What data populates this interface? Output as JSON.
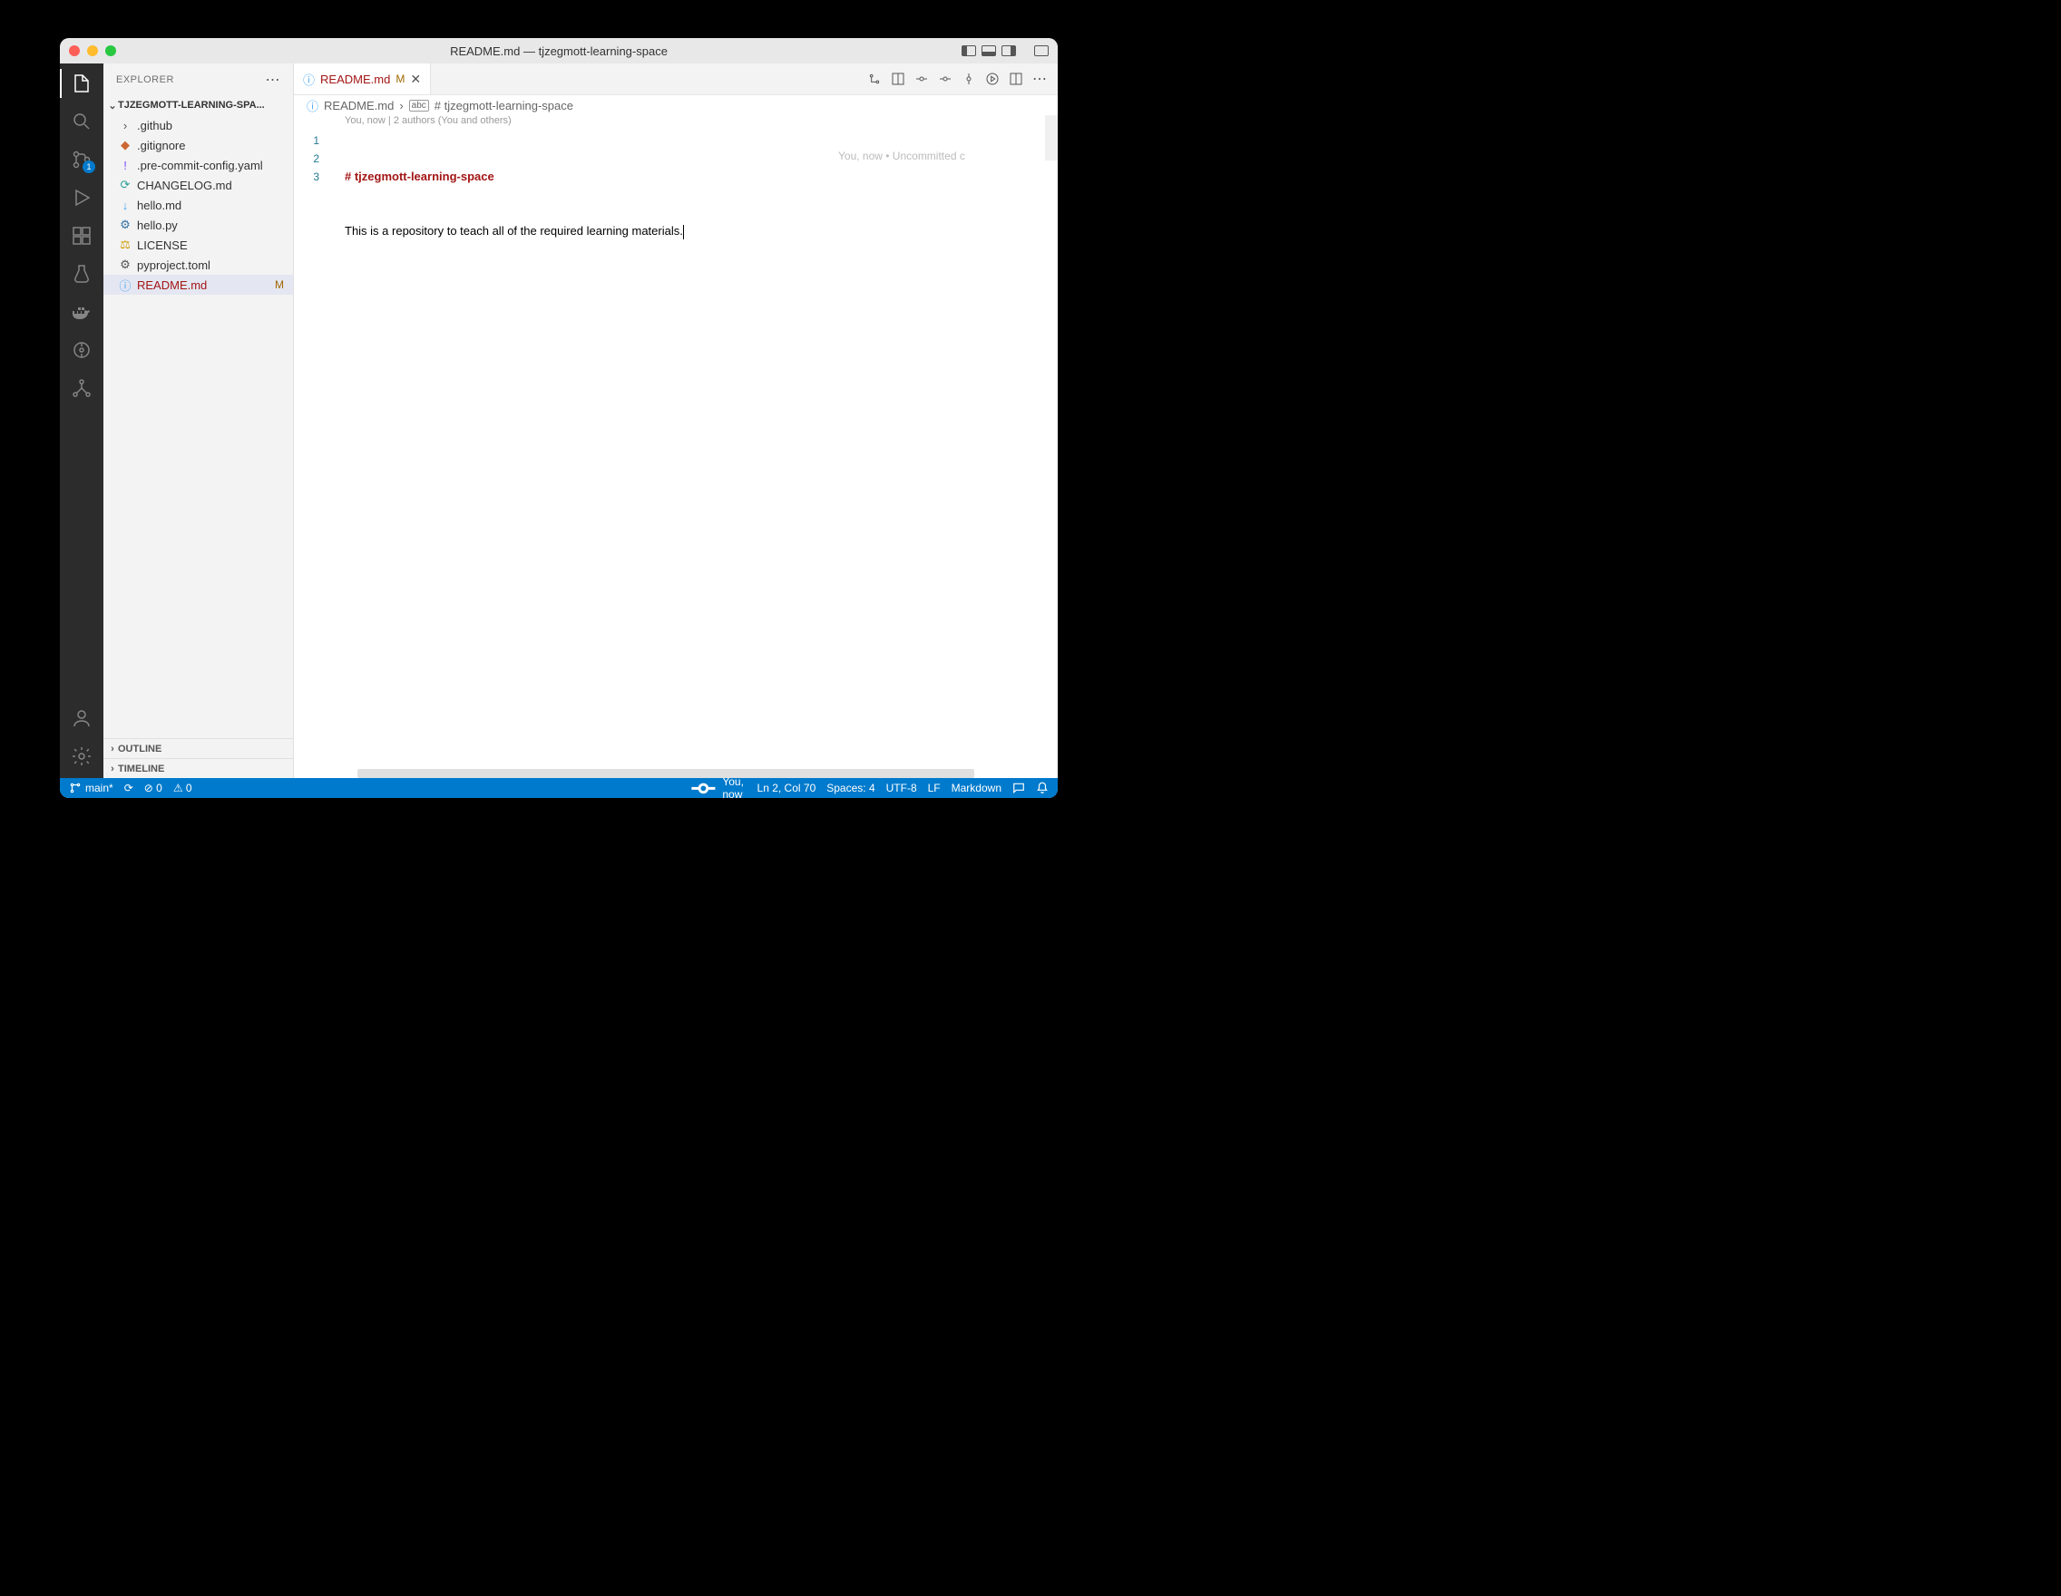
{
  "window": {
    "title": "README.md — tjzegmott-learning-space"
  },
  "traffic": {
    "close": "#ff5f57",
    "min": "#febc2e",
    "max": "#28c840"
  },
  "sidebar": {
    "title": "EXPLORER",
    "project": "TJZEGMOTT-LEARNING-SPA...",
    "files": [
      {
        "icon": "›",
        "iconColor": "#555",
        "name": ".github",
        "folder": true
      },
      {
        "icon": "◆",
        "iconColor": "#cc6633",
        "name": ".gitignore"
      },
      {
        "icon": "!",
        "iconColor": "#7c4dff",
        "name": ".pre-commit-config.yaml"
      },
      {
        "icon": "⟳",
        "iconColor": "#2aa198",
        "name": "CHANGELOG.md"
      },
      {
        "icon": "↓",
        "iconColor": "#42a5f5",
        "name": "hello.md"
      },
      {
        "icon": "⚙",
        "iconColor": "#3572A5",
        "name": "hello.py"
      },
      {
        "icon": "⚖",
        "iconColor": "#cc9900",
        "name": "LICENSE"
      },
      {
        "icon": "⚙",
        "iconColor": "#555",
        "name": "pyproject.toml"
      },
      {
        "icon": "ⓘ",
        "iconColor": "#42a5f5",
        "name": "README.md",
        "status": "M",
        "selected": true
      }
    ],
    "outline": "OUTLINE",
    "timeline": "TIMELINE"
  },
  "tab": {
    "icon": "ⓘ",
    "name": "README.md",
    "modified": "M"
  },
  "breadcrumb": {
    "icon": "ⓘ",
    "file": "README.md",
    "sep": "›",
    "symbol": "# tjzegmott-learning-space"
  },
  "editor": {
    "annotation": "You, now | 2 authors (You and others)",
    "line1": "# tjzegmott-learning-space",
    "line2": "This is a repository to teach all of the required learning materials.",
    "blame": "You, now • Uncommitted c"
  },
  "activity": {
    "scm_badge": "1"
  },
  "status": {
    "branch": "main*",
    "sync": "⟳",
    "errors": "⊘ 0",
    "warnings": "⚠ 0",
    "blame_user": "You, now",
    "cursor": "Ln 2, Col 70",
    "spaces": "Spaces: 4",
    "encoding": "UTF-8",
    "eol": "LF",
    "lang": "Markdown"
  }
}
